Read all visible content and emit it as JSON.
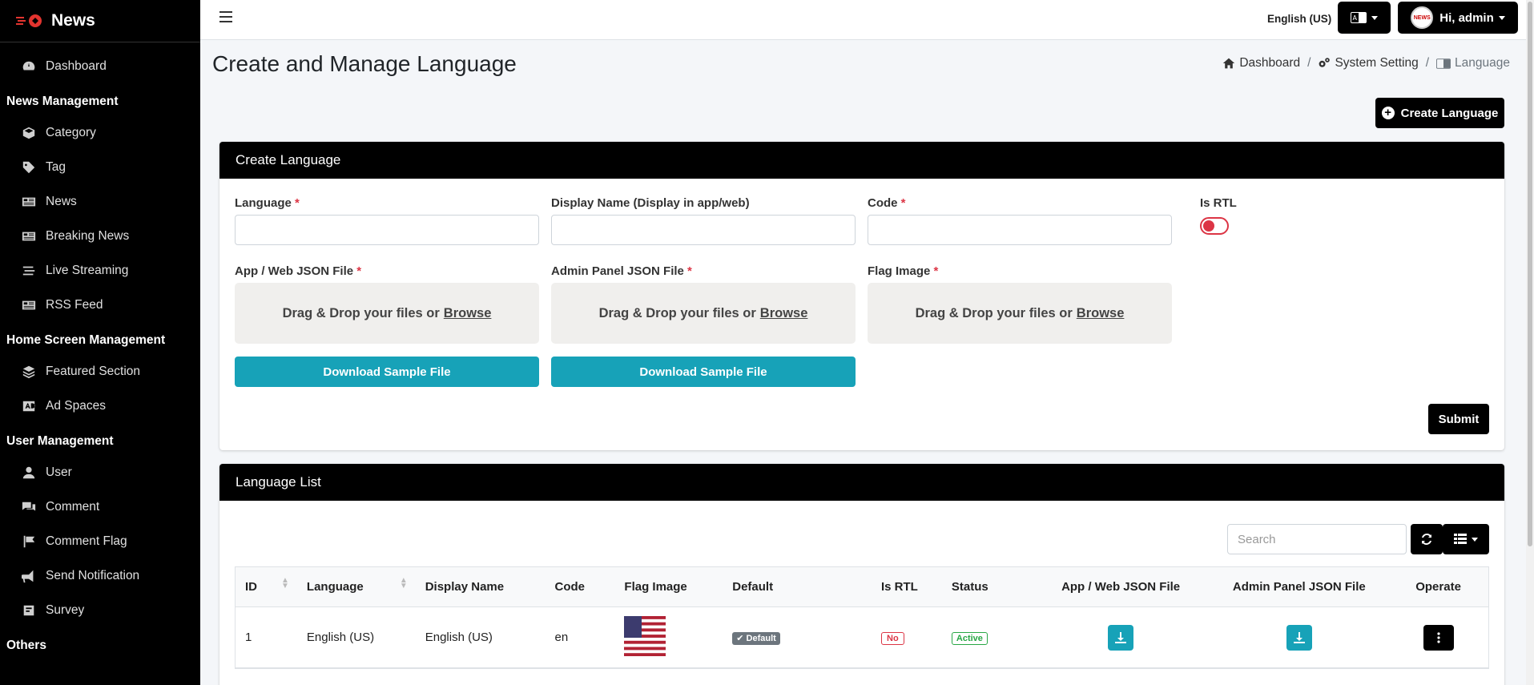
{
  "brand": {
    "name": "News"
  },
  "sidebar": {
    "dashboard": "Dashboard",
    "sections": [
      {
        "header": "News Management",
        "items": [
          {
            "label": "Category",
            "icon": "box-icon"
          },
          {
            "label": "Tag",
            "icon": "tag-icon"
          },
          {
            "label": "News",
            "icon": "newspaper-icon"
          },
          {
            "label": "Breaking News",
            "icon": "newspaper-icon"
          },
          {
            "label": "Live Streaming",
            "icon": "stream-icon"
          },
          {
            "label": "RSS Feed",
            "icon": "newspaper-icon"
          }
        ]
      },
      {
        "header": "Home Screen Management",
        "items": [
          {
            "label": "Featured Section",
            "icon": "layers-icon"
          },
          {
            "label": "Ad Spaces",
            "icon": "ad-icon"
          }
        ]
      },
      {
        "header": "User Management",
        "items": [
          {
            "label": "User",
            "icon": "user-icon"
          },
          {
            "label": "Comment",
            "icon": "comments-icon"
          },
          {
            "label": "Comment Flag",
            "icon": "flag-icon"
          },
          {
            "label": "Send Notification",
            "icon": "bullhorn-icon"
          },
          {
            "label": "Survey",
            "icon": "poll-icon"
          }
        ]
      }
    ],
    "others": "Others"
  },
  "topbar": {
    "language": "English (US)",
    "greeting": "Hi, admin",
    "avatar_text": "NEWS"
  },
  "page": {
    "title": "Create and Manage Language",
    "create_button": "Create Language"
  },
  "breadcrumb": {
    "home": "Dashboard",
    "system": "System Setting",
    "current": "Language"
  },
  "form": {
    "header": "Create Language",
    "language_label": "Language",
    "display_name_label": "Display Name (Display in app/web)",
    "code_label": "Code",
    "rtl_label": "Is RTL",
    "app_json_label": "App / Web JSON File",
    "admin_json_label": "Admin Panel JSON File",
    "flag_label": "Flag Image",
    "dropzone_text": "Drag & Drop your files or",
    "browse": "Browse",
    "download_sample": "Download Sample File",
    "submit": "Submit",
    "required_mark": "*"
  },
  "list": {
    "header": "Language List",
    "search_placeholder": "Search",
    "columns": [
      "ID",
      "Language",
      "Display Name",
      "Code",
      "Flag Image",
      "Default",
      "Is RTL",
      "Status",
      "App / Web JSON File",
      "Admin Panel JSON File",
      "Operate"
    ],
    "rows": [
      {
        "id": "1",
        "language": "English (US)",
        "display_name": "English (US)",
        "code": "en",
        "default": "Default",
        "rtl": "No",
        "status": "Active"
      }
    ]
  }
}
